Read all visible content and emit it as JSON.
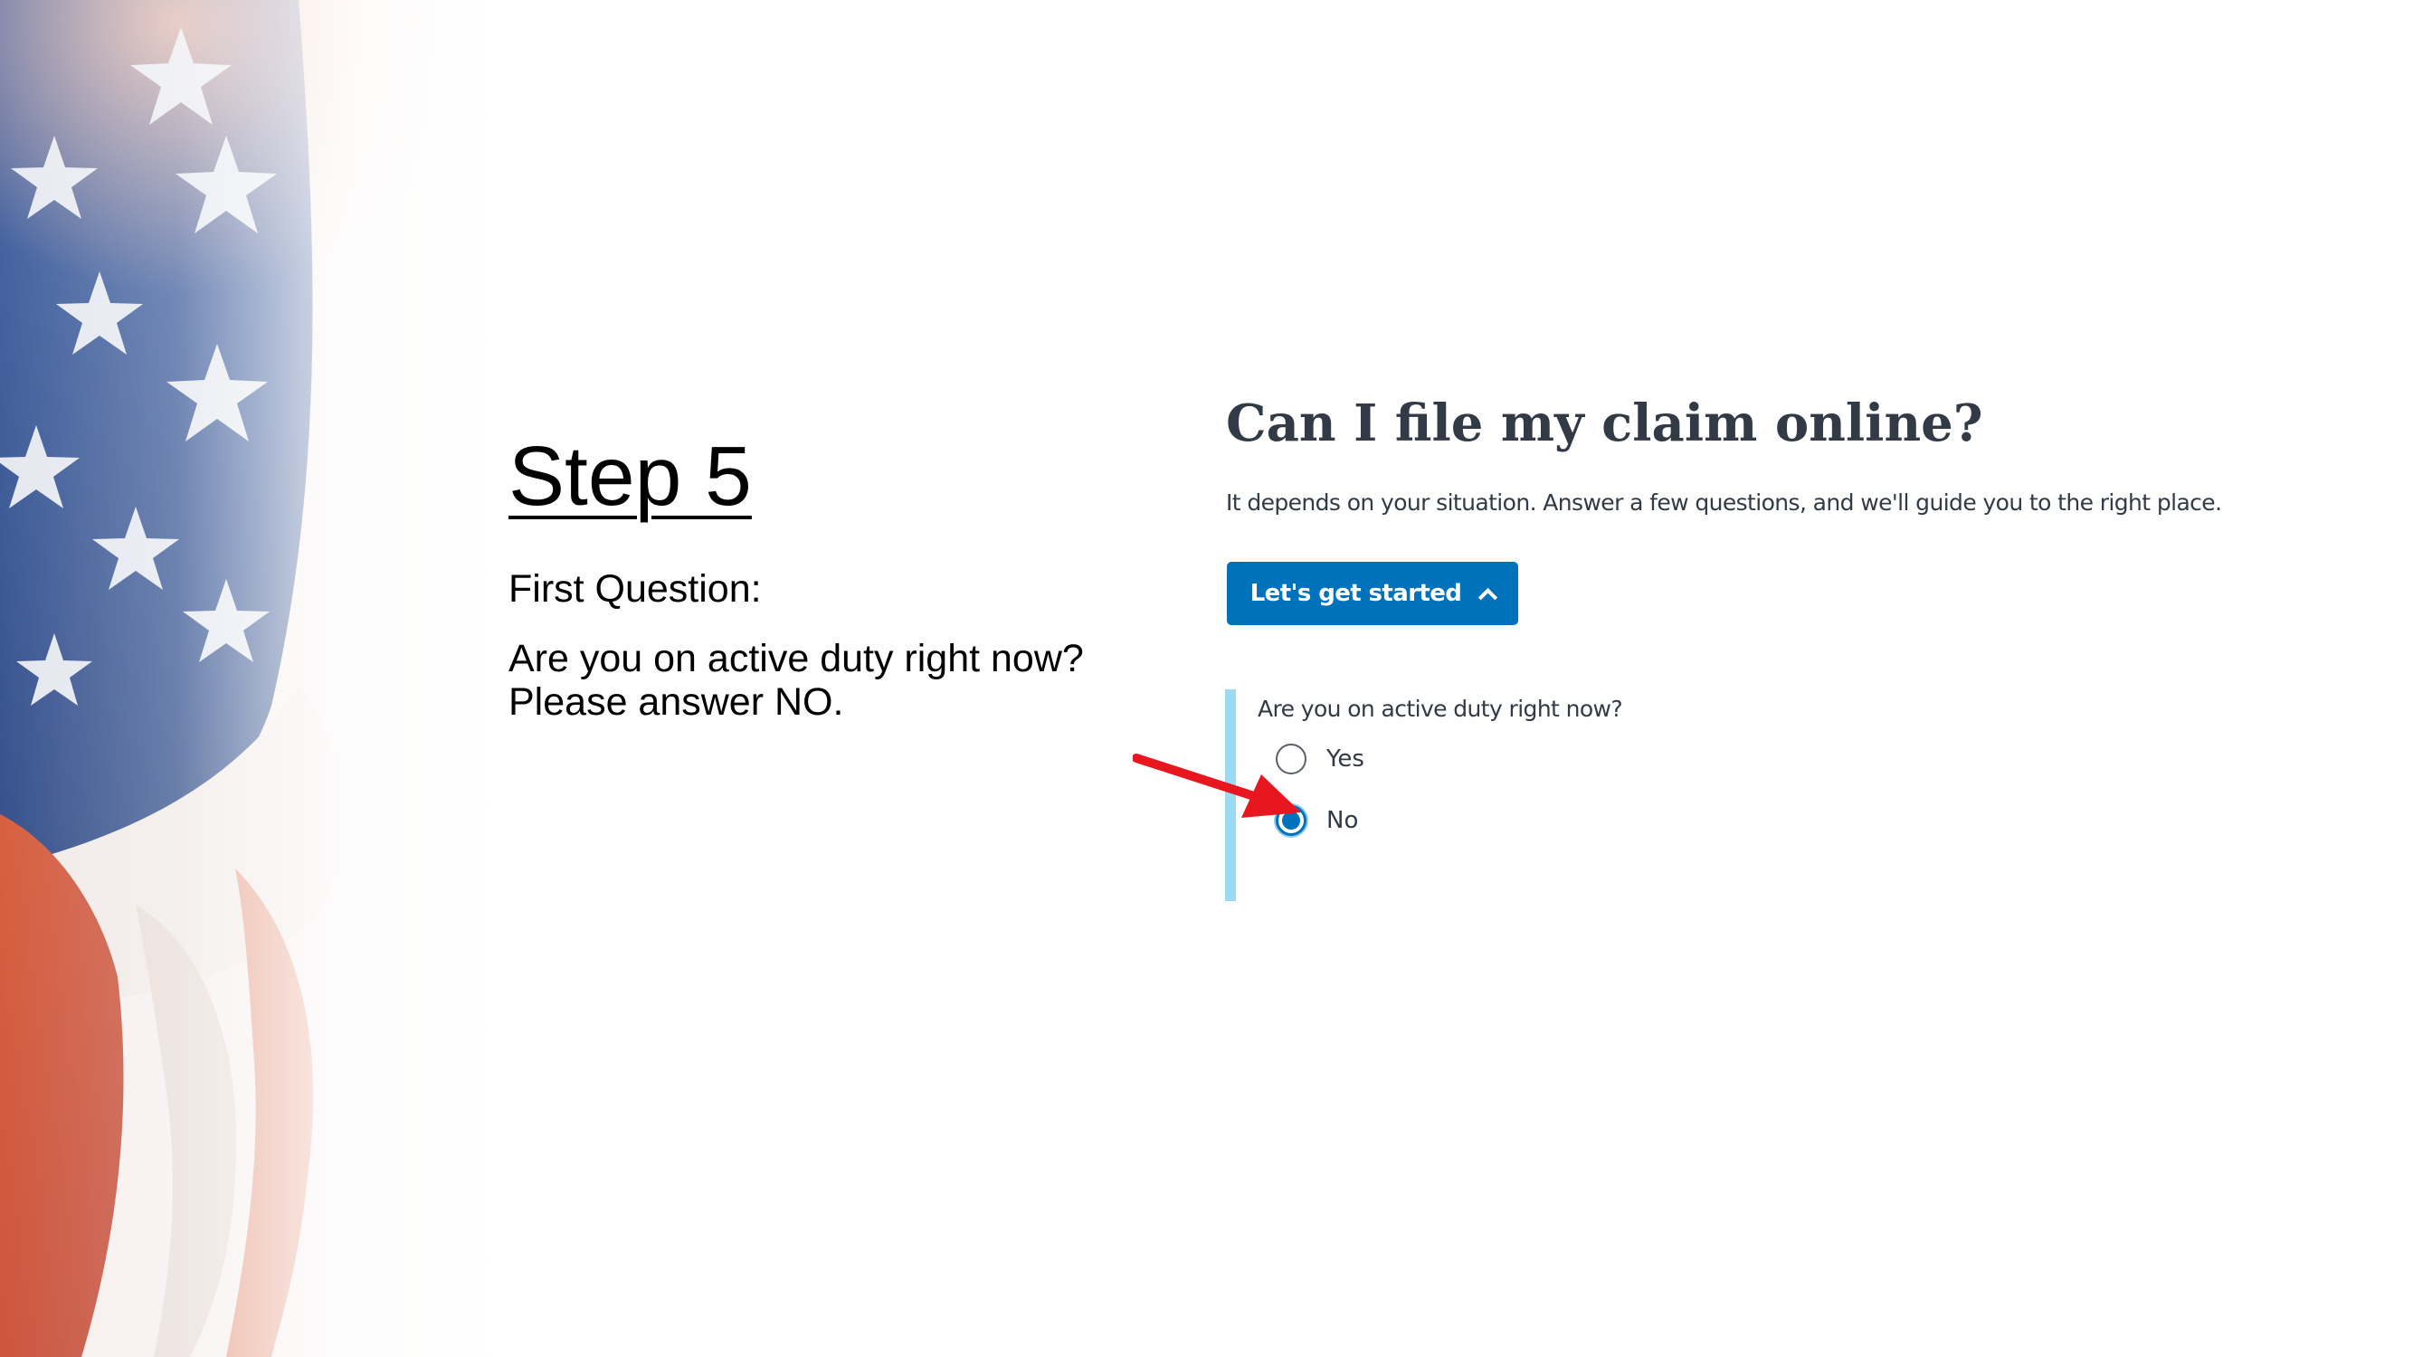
{
  "slide": {
    "step_title": "Step 5",
    "first_question": "First Question:",
    "instruction_line1": "Are you on active duty right now?",
    "instruction_line2": "Please answer NO."
  },
  "web_page": {
    "heading": "Can I file my claim online?",
    "subtext": "It depends on your situation. Answer a few questions, and we'll guide you to the right place.",
    "start_button_label": "Let's get started",
    "start_button_icon": "chevron-up-icon",
    "question": {
      "label": "Are you on active duty right now?",
      "options": [
        {
          "label": "Yes",
          "selected": false
        },
        {
          "label": "No",
          "selected": true
        }
      ]
    }
  },
  "annotation": {
    "arrow_icon": "red-arrow-icon",
    "arrow_target": "No"
  },
  "colors": {
    "button_blue": "#0071bb",
    "accent_bar": "#9bdaf1",
    "heading_text": "#323a45",
    "arrow_red": "#e8171f"
  }
}
